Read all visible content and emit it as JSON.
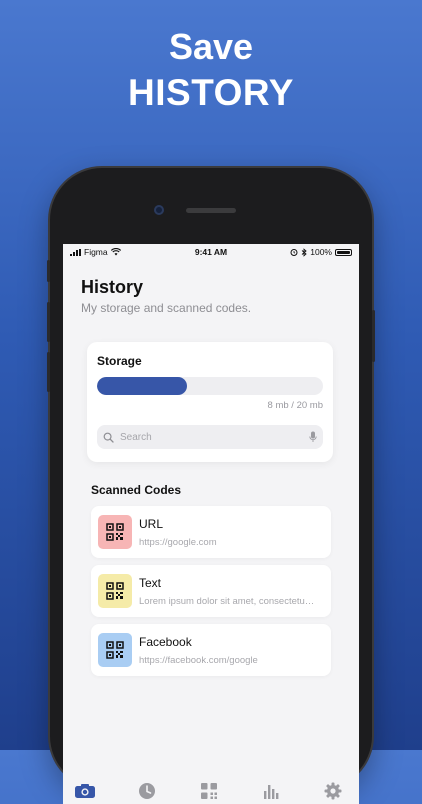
{
  "headline": {
    "line1": "Save",
    "line2": "HISTORY"
  },
  "status_bar": {
    "carrier": "Figma",
    "time": "9:41 AM",
    "battery": "100%"
  },
  "page": {
    "title": "History",
    "subtitle": "My storage and scanned codes."
  },
  "storage": {
    "label": "Storage",
    "used_text": "8 mb / 20 mb",
    "used_fraction": 0.4,
    "search_placeholder": "Search"
  },
  "scanned": {
    "section_title": "Scanned Codes",
    "items": [
      {
        "title": "URL",
        "subtitle": "https://google.com",
        "color": "#f7b5b5"
      },
      {
        "title": "Text",
        "subtitle": "Lorem ipsum dolor sit amet, consectetu…",
        "color": "#f5eba8"
      },
      {
        "title": "Facebook",
        "subtitle": "https://facebook.com/google",
        "color": "#a9cdf3"
      }
    ]
  },
  "tabs": [
    {
      "icon": "camera-icon",
      "active": true
    },
    {
      "icon": "clock-icon",
      "active": false
    },
    {
      "icon": "qr-code-icon",
      "active": false
    },
    {
      "icon": "bar-chart-icon",
      "active": false
    },
    {
      "icon": "gear-icon",
      "active": false
    }
  ],
  "colors": {
    "accent": "#3756a8",
    "inactive": "#9b9ba0"
  }
}
